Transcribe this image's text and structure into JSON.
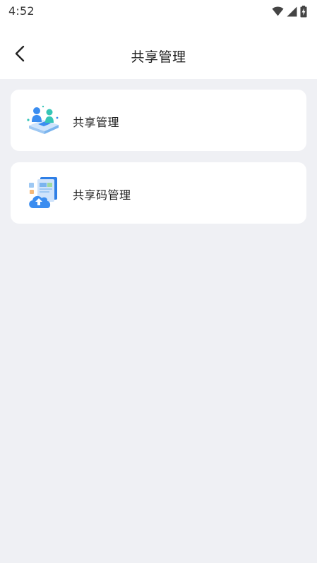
{
  "status_bar": {
    "time": "4:52",
    "icons": [
      "wifi-icon",
      "cell-signal-icon",
      "battery-charging-icon"
    ]
  },
  "header": {
    "title": "共享管理",
    "back_icon": "chevron-left-icon"
  },
  "menu": {
    "items": [
      {
        "label": "共享管理",
        "icon": "people-share-illustration-icon"
      },
      {
        "label": "共享码管理",
        "icon": "cloud-upload-files-illustration-icon"
      }
    ]
  },
  "colors": {
    "page_background": "#eff0f4",
    "card_background": "#ffffff",
    "text_primary": "#1e1e1e",
    "icon_blue": "#3b8df0",
    "icon_teal": "#35c5b7"
  }
}
